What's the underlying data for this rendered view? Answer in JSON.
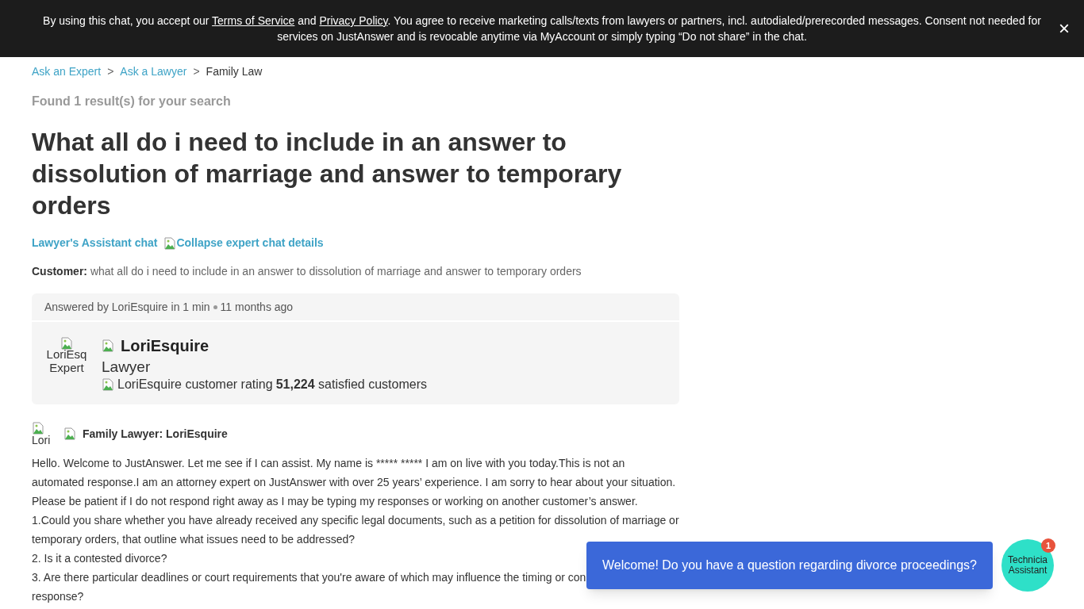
{
  "consent_banner": {
    "parts": [
      {
        "text": "By using this chat, you accept our ",
        "link": false
      },
      {
        "text": "Terms of Service",
        "link": true
      },
      {
        "text": " and ",
        "link": false
      },
      {
        "text": "Privacy Policy",
        "link": true
      },
      {
        "text": ". You agree to receive marketing calls/texts from lawyers or partners, incl. autodialed/prerecorded messages. Consent not needed for services on JustAnswer and is revocable anytime via MyAccount or simply typing “Do not share” in the chat.",
        "link": false
      }
    ],
    "close": "×"
  },
  "breadcrumbs": [
    {
      "label": "Ask an Expert",
      "link": true
    },
    {
      "label": "Ask a Lawyer",
      "link": true
    },
    {
      "label": "Family Law",
      "link": false
    }
  ],
  "separator": ">",
  "results_note": "Found 1 result(s) for your search",
  "title": "What all do i need to include in an answer to dissolution of marriage and answer to temporary orders",
  "chat_links": [
    "Lawyer's Assistant chat",
    "Collapse expert chat details"
  ],
  "customer": {
    "label": "Customer:",
    "question": "what all do i need to include in an answer to dissolution of marriage and answer to temporary orders"
  },
  "answer_card": {
    "meta": "Answered by LoriEsquire in 1 min",
    "time": "11 months ago",
    "avatar_alt": [
      "LoriEsq",
      "Expert"
    ],
    "name": "LoriEsquire",
    "role": "Lawyer",
    "rating_alt": "LoriEsquire customer rating",
    "count": "51,224",
    "count_label": "satisfied customers"
  },
  "message": {
    "avatar_alt": "Lori",
    "author": "Family Lawyer: LoriEsquire",
    "lines": [
      "Hello. Welcome to JustAnswer. Let me see if I can assist. My name is ***** ***** I am on live with you today.This is not an",
      "automated response.I am an attorney expert on JustAnswer with over 25 years’ experience. I am sorry to hear about your situation.",
      "Please be patient if I do not respond right away as I may be typing my responses or working on another customer’s answer.",
      "1.Could you share whether you have already received any specific legal documents, such as a petition for dissolution of marriage or",
      "temporary orders, that outline what issues need to be addressed?",
      "2. Is it a contested divorce?",
      "3. Are there particular deadlines or court requirements that you're aware of which may influence the timing or con",
      "response?"
    ]
  },
  "chat_popup": {
    "message": "Welcome! Do you have a question regarding divorce proceedings?",
    "avatar_alt": [
      "Technicia",
      "Assistant"
    ],
    "badge": "1"
  }
}
